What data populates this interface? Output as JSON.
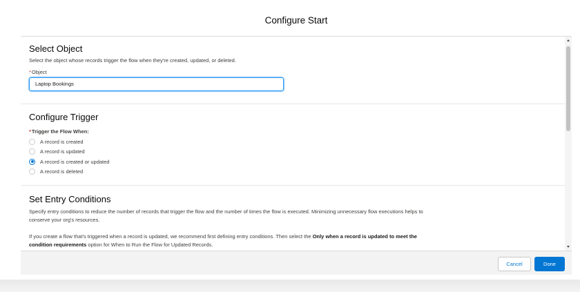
{
  "modal": {
    "title": "Configure Start"
  },
  "select_object": {
    "heading": "Select Object",
    "description": "Select the object whose records trigger the flow when they're created, updated, or deleted.",
    "required_marker": "*",
    "field_label": "Object",
    "field_value": "Laptop Bookings"
  },
  "configure_trigger": {
    "heading": "Configure Trigger",
    "required_marker": "*",
    "label": "Trigger the Flow When:",
    "options": [
      {
        "label": "A record is created",
        "checked": false
      },
      {
        "label": "A record is updated",
        "checked": false
      },
      {
        "label": "A record is created or updated",
        "checked": true
      },
      {
        "label": "A record is deleted",
        "checked": false
      }
    ]
  },
  "entry_conditions": {
    "heading": "Set Entry Conditions",
    "paragraph1": "Specify entry conditions to reduce the number of records that trigger the flow and the number of times the flow is executed. Minimizing unnecessary flow executions helps to conserve your org's resources.",
    "paragraph2_part1": "If you create a flow that's triggered when a record is updated, we recommend first defining entry conditions. Then select the ",
    "paragraph2_bold": "Only when a record is updated to meet the condition requirements",
    "paragraph2_part2": " option for When to Run the Flow for Updated Records."
  },
  "footer": {
    "cancel_label": "Cancel",
    "done_label": "Done"
  },
  "colors": {
    "brand": "#0176d3",
    "required": "#c23934",
    "footer_bg": "#f3f3f3"
  }
}
